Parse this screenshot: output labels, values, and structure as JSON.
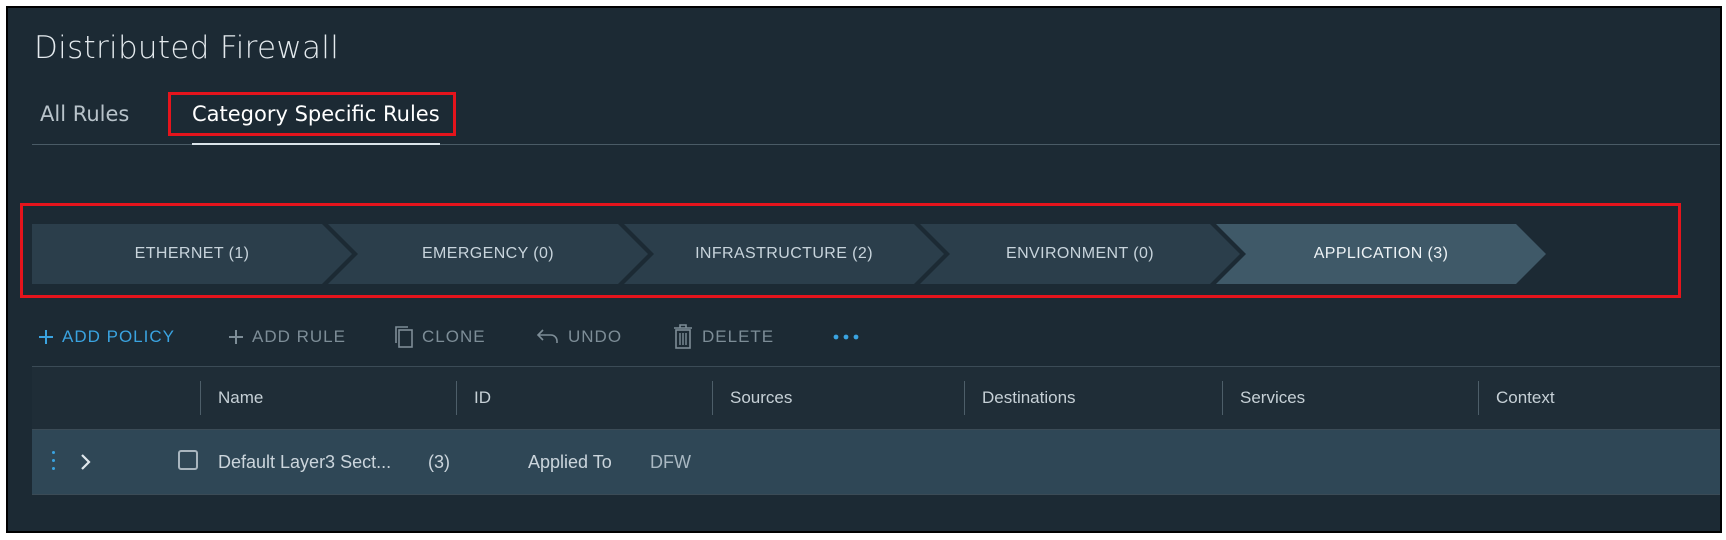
{
  "page": {
    "title": "Distributed Firewall"
  },
  "tabs": [
    {
      "label": "All Rules"
    },
    {
      "label": "Category Specific Rules",
      "selected": true
    }
  ],
  "categories": [
    {
      "label": "ETHERNET (1)"
    },
    {
      "label": "EMERGENCY (0)"
    },
    {
      "label": "INFRASTRUCTURE (2)"
    },
    {
      "label": "ENVIRONMENT (0)"
    },
    {
      "label": "APPLICATION (3)",
      "active": true
    }
  ],
  "toolbar": {
    "add_policy": "ADD POLICY",
    "add_rule": "ADD RULE",
    "clone": "CLONE",
    "undo": "UNDO",
    "delete": "DELETE"
  },
  "table": {
    "columns": [
      "Name",
      "ID",
      "Sources",
      "Destinations",
      "Services",
      "Context"
    ],
    "rows": [
      {
        "name": "Default Layer3 Sect...",
        "count": "(3)",
        "applied_to_label": "Applied To",
        "applied_to_value": "DFW"
      }
    ]
  },
  "colors": {
    "background": "#1c2a34",
    "accent": "#3aa3e0",
    "highlight": "#e5141c",
    "active_category": "#3f5968"
  }
}
